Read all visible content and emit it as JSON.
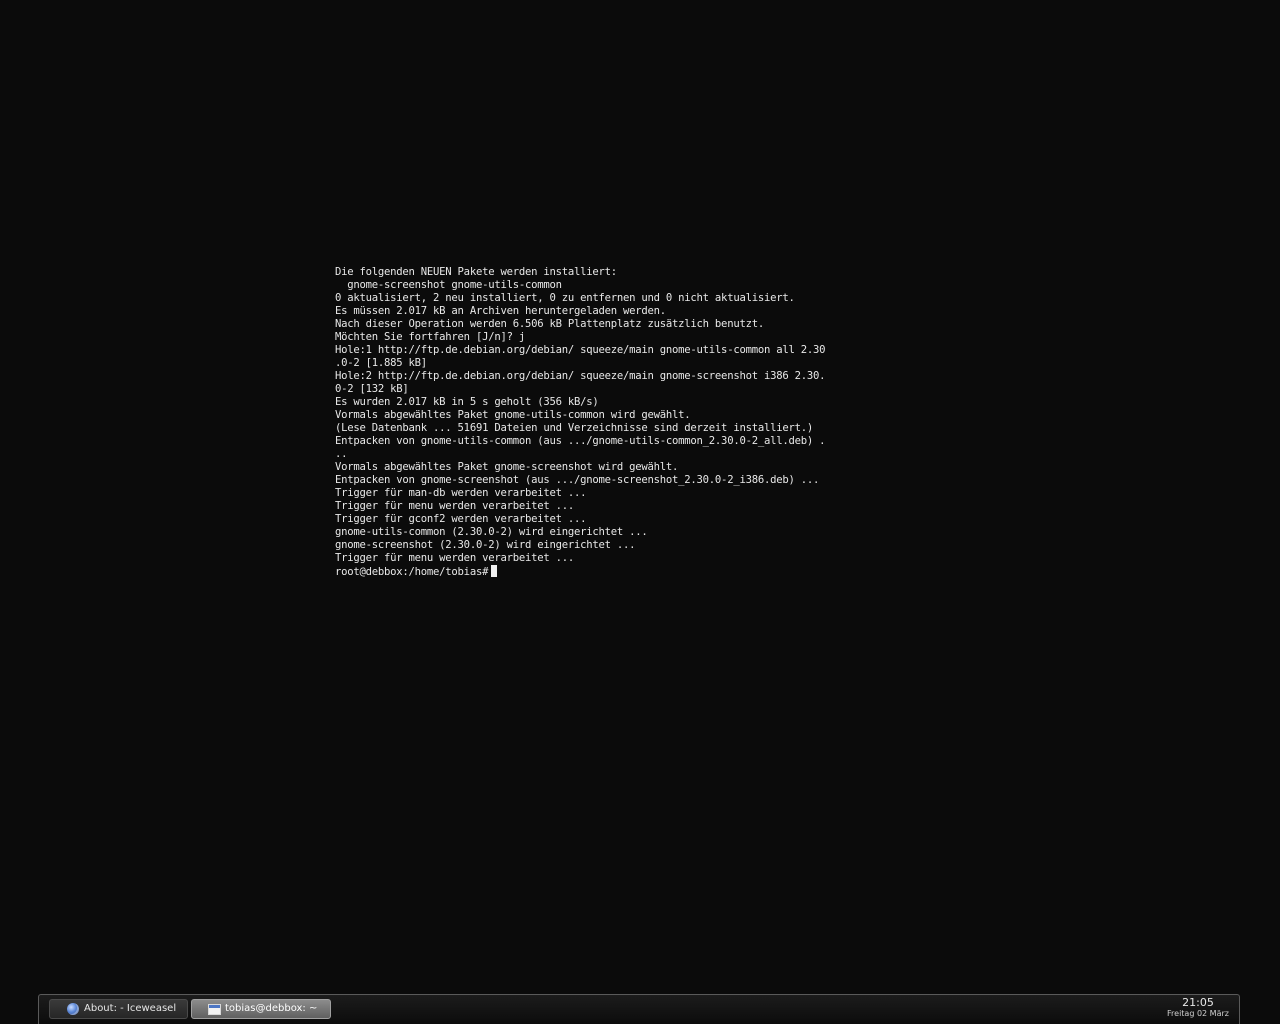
{
  "terminal": {
    "lines": [
      "Die folgenden NEUEN Pakete werden installiert:",
      "  gnome-screenshot gnome-utils-common",
      "0 aktualisiert, 2 neu installiert, 0 zu entfernen und 0 nicht aktualisiert.",
      "Es müssen 2.017 kB an Archiven heruntergeladen werden.",
      "Nach dieser Operation werden 6.506 kB Plattenplatz zusätzlich benutzt.",
      "Möchten Sie fortfahren [J/n]? j",
      "Hole:1 http://ftp.de.debian.org/debian/ squeeze/main gnome-utils-common all 2.30",
      ".0-2 [1.885 kB]",
      "Hole:2 http://ftp.de.debian.org/debian/ squeeze/main gnome-screenshot i386 2.30.",
      "0-2 [132 kB]",
      "Es wurden 2.017 kB in 5 s geholt (356 kB/s)",
      "Vormals abgewähltes Paket gnome-utils-common wird gewählt.",
      "(Lese Datenbank ... 51691 Dateien und Verzeichnisse sind derzeit installiert.)",
      "Entpacken von gnome-utils-common (aus .../gnome-utils-common_2.30.0-2_all.deb) .",
      "..",
      "Vormals abgewähltes Paket gnome-screenshot wird gewählt.",
      "Entpacken von gnome-screenshot (aus .../gnome-screenshot_2.30.0-2_i386.deb) ...",
      "Trigger für man-db werden verarbeitet ...",
      "Trigger für menu werden verarbeitet ...",
      "Trigger für gconf2 werden verarbeitet ...",
      "gnome-utils-common (2.30.0-2) wird eingerichtet ...",
      "gnome-screenshot (2.30.0-2) wird eingerichtet ...",
      "Trigger für menu werden verarbeitet ..."
    ],
    "prompt": "root@debbox:/home/tobias#"
  },
  "taskbar": {
    "tasks": [
      {
        "label": "About: - Iceweasel",
        "icon": "globe-icon",
        "active": false
      },
      {
        "label": "tobias@debbox: ~",
        "icon": "terminal-window-icon",
        "active": true
      }
    ],
    "clock": {
      "time": "21:05",
      "date": "Freitag 02 März"
    }
  }
}
